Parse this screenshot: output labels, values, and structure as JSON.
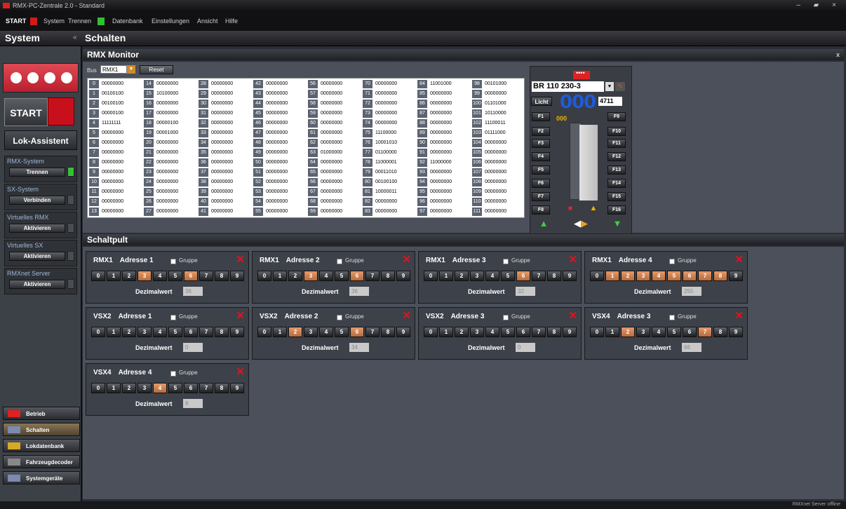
{
  "window": {
    "title": "RMX-PC-Zentrale 2.0 - Standard",
    "controls": "– ▰ ×"
  },
  "menu": {
    "start": "START",
    "system": "System",
    "trennen": "Trennen",
    "datenbank": "Datenbank",
    "einstellungen": "Einstellungen",
    "ansicht": "Ansicht",
    "hilfe": "Hilfe"
  },
  "sidebar": {
    "title": "System",
    "collapse": "«",
    "start": "START",
    "lok_assistent": "Lok-Assistent",
    "sections": [
      {
        "label": "RMX-System",
        "button": "Trennen",
        "active": true
      },
      {
        "label": "SX-System",
        "button": "Verbinden",
        "active": false
      },
      {
        "label": "Virtuelles RMX",
        "button": "Aktivieren",
        "active": false
      },
      {
        "label": "Virtuelles SX",
        "button": "Aktivieren",
        "active": false
      },
      {
        "label": "RMXnet Server",
        "button": "Aktivieren",
        "active": false
      }
    ],
    "nav": [
      {
        "label": "Betrieb",
        "active": false
      },
      {
        "label": "Schalten",
        "active": true
      },
      {
        "label": "Lokdatenbank",
        "active": false
      },
      {
        "label": "Fahrzeugdecoder",
        "active": false
      },
      {
        "label": "Systemgeräte",
        "active": false
      }
    ]
  },
  "main": {
    "title": "Schalten"
  },
  "monitor": {
    "title": "RMX Monitor",
    "close": "x",
    "bus_label": "Bus",
    "bus_value": "RMX1",
    "reset": "Reset",
    "registers": [
      [
        "0",
        "00000000",
        "14",
        "00000000",
        "28",
        "00000000",
        "42",
        "00000000",
        "56",
        "00000000",
        "70",
        "00000000",
        "84",
        "11001000",
        "98",
        "00101000"
      ],
      [
        "1",
        "00100100",
        "15",
        "10100000",
        "29",
        "00000000",
        "43",
        "00000000",
        "57",
        "00000000",
        "71",
        "00000000",
        "85",
        "00000000",
        "99",
        "00000000"
      ],
      [
        "2",
        "00100100",
        "16",
        "00000000",
        "30",
        "00000000",
        "44",
        "00000000",
        "58",
        "00000000",
        "72",
        "00000000",
        "86",
        "00000000",
        "100",
        "01101000"
      ],
      [
        "3",
        "00000100",
        "17",
        "00000000",
        "31",
        "00000000",
        "45",
        "00000000",
        "59",
        "00000000",
        "73",
        "00000000",
        "87",
        "00000000",
        "101",
        "10110000"
      ],
      [
        "4",
        "11111111",
        "18",
        "00000100",
        "32",
        "00000000",
        "46",
        "00000000",
        "60",
        "00000000",
        "74",
        "00000000",
        "88",
        "00000000",
        "102",
        "11100011"
      ],
      [
        "5",
        "00000000",
        "19",
        "00001000",
        "33",
        "00000000",
        "47",
        "00000000",
        "61",
        "00000000",
        "75",
        "11100000",
        "89",
        "00000000",
        "103",
        "01111000"
      ],
      [
        "6",
        "00000000",
        "20",
        "00000000",
        "34",
        "00000000",
        "48",
        "00000000",
        "62",
        "00000000",
        "76",
        "10001010",
        "90",
        "00000000",
        "104",
        "00000000"
      ],
      [
        "7",
        "00000000",
        "21",
        "00000000",
        "35",
        "00000000",
        "49",
        "00000000",
        "63",
        "01000000",
        "77",
        "01100000",
        "91",
        "00000000",
        "105",
        "00000000"
      ],
      [
        "8",
        "00000000",
        "22",
        "00000000",
        "36",
        "00000000",
        "50",
        "00000000",
        "64",
        "00000000",
        "78",
        "11000001",
        "92",
        "11000000",
        "106",
        "00000000"
      ],
      [
        "9",
        "00000000",
        "23",
        "00000000",
        "37",
        "00000000",
        "51",
        "00000000",
        "65",
        "00000000",
        "79",
        "00011010",
        "93",
        "00000000",
        "107",
        "00000000"
      ],
      [
        "10",
        "00000000",
        "24",
        "00000000",
        "38",
        "00000000",
        "52",
        "00000000",
        "66",
        "00000000",
        "80",
        "00100100",
        "94",
        "00000000",
        "108",
        "00000000"
      ],
      [
        "11",
        "00000000",
        "25",
        "00000000",
        "39",
        "00000000",
        "53",
        "00000000",
        "67",
        "00000000",
        "81",
        "10000011",
        "95",
        "00000000",
        "109",
        "00000000"
      ],
      [
        "12",
        "00000000",
        "26",
        "00000000",
        "40",
        "00000000",
        "54",
        "00000000",
        "68",
        "00000000",
        "82",
        "00000000",
        "96",
        "00000000",
        "110",
        "00000000"
      ],
      [
        "13",
        "00000000",
        "27",
        "00000000",
        "41",
        "00000000",
        "55",
        "00000000",
        "69",
        "00000000",
        "83",
        "00000000",
        "97",
        "00000000",
        "111",
        "00000000"
      ]
    ]
  },
  "loco": {
    "dots": "••••",
    "name": "BR 110 230-3",
    "licht": "Licht",
    "speed": "000",
    "small_speed": "000",
    "address": "4711",
    "left_f": [
      "F1",
      "F2",
      "F3",
      "F4",
      "F5",
      "F6",
      "F7",
      "F8"
    ],
    "right_f": [
      "F9",
      "F10",
      "F11",
      "F12",
      "F13",
      "F14",
      "F15",
      "F16"
    ]
  },
  "schaltpult": {
    "title": "Schaltpult",
    "gruppe": "Gruppe",
    "dezimal": "Dezimalwert",
    "cards": [
      {
        "bus": "RMX1",
        "adr": "Adresse 1",
        "on": [
          3,
          6
        ],
        "value": "36"
      },
      {
        "bus": "RMX1",
        "adr": "Adresse 2",
        "on": [
          3,
          6
        ],
        "value": "36"
      },
      {
        "bus": "RMX1",
        "adr": "Adresse 3",
        "on": [
          6
        ],
        "value": "32"
      },
      {
        "bus": "RMX1",
        "adr": "Adresse 4",
        "on": [
          1,
          2,
          3,
          4,
          5,
          6,
          7,
          8
        ],
        "value": "255"
      },
      {
        "bus": "VSX2",
        "adr": "Adresse 1",
        "on": [],
        "value": "0"
      },
      {
        "bus": "VSX2",
        "adr": "Adresse 2",
        "on": [
          2,
          6
        ],
        "value": "34"
      },
      {
        "bus": "VSX2",
        "adr": "Adresse 3",
        "on": [],
        "value": "0"
      },
      {
        "bus": "VSX4",
        "adr": "Adresse 3",
        "on": [
          2,
          7
        ],
        "value": "66"
      },
      {
        "bus": "VSX4",
        "adr": "Adresse 4",
        "on": [
          4
        ],
        "value": "8"
      }
    ]
  },
  "status": {
    "text": "RMXnet Server offline"
  }
}
